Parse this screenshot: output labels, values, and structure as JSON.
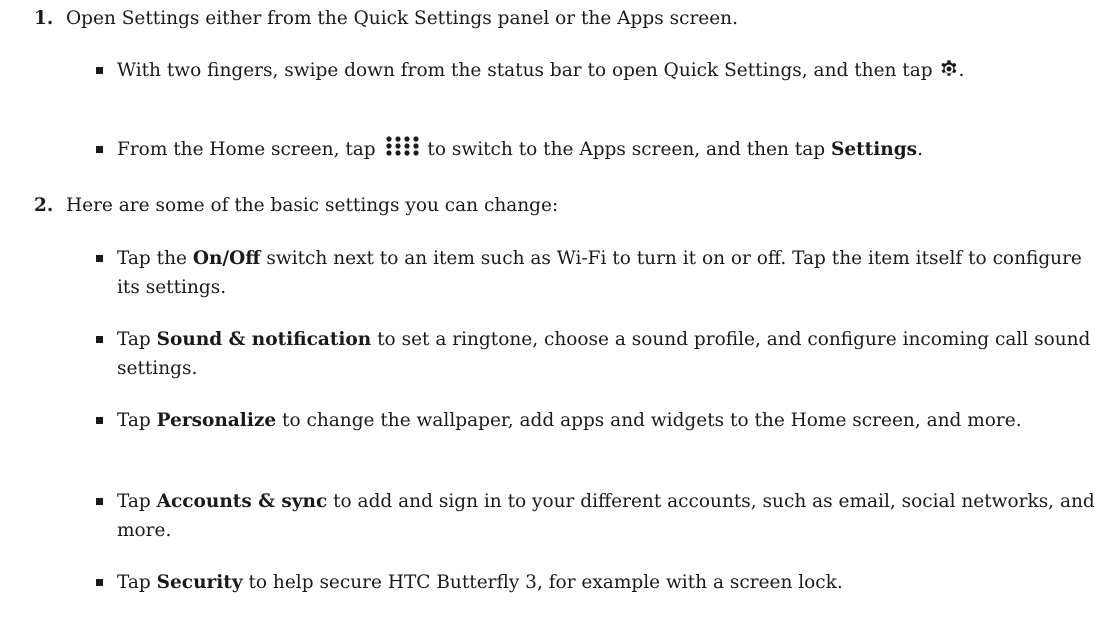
{
  "steps": [
    {
      "number": "1.",
      "text": "Open Settings either from the Quick Settings panel or the Apps screen.",
      "bullets": [
        {
          "pre": "With two fingers, swipe down from the status bar to open Quick Settings, and then tap",
          "icon": "gear-icon",
          "post": "."
        },
        {
          "pre": "From the Home screen, tap",
          "icon": "apps-grid-icon",
          "mid": "to switch to the Apps screen, and then tap",
          "bold": "Settings",
          "post": "."
        }
      ]
    },
    {
      "number": "2.",
      "text": "Here are some of the basic settings you can change:",
      "bullets": [
        {
          "pre": "Tap the",
          "bold": "On/Off",
          "post": "switch next to an item such as Wi-Fi to turn it on or off. Tap the item itself to configure its settings."
        },
        {
          "pre": "Tap",
          "bold": "Sound & notification",
          "post": "to set a ringtone, choose a sound profile, and configure incoming call sound settings."
        },
        {
          "pre": "Tap",
          "bold": "Personalize",
          "post": "to change the wallpaper, add apps and widgets to the Home screen, and more."
        },
        {
          "pre": "Tap",
          "bold": "Accounts & sync",
          "post": "to add and sign in to your different accounts, such as email, social networks, and more."
        },
        {
          "pre": "Tap",
          "bold": "Security",
          "post": "to help secure HTC Butterfly 3, for example with a screen lock."
        }
      ]
    }
  ]
}
